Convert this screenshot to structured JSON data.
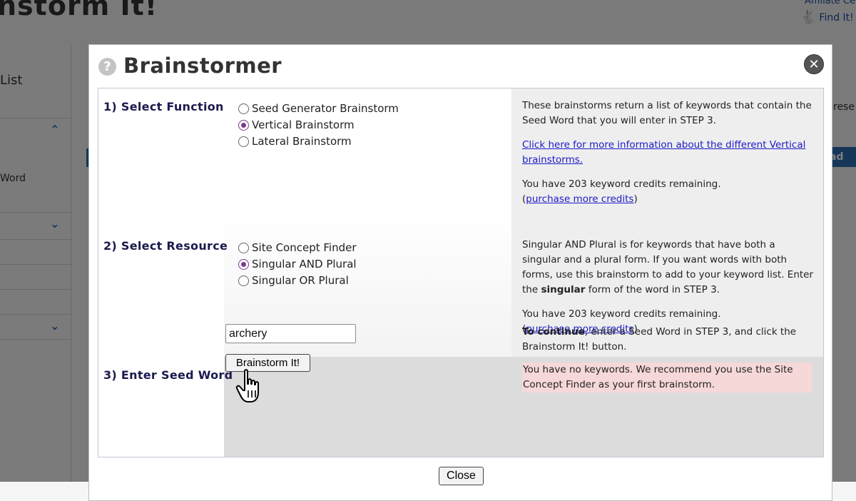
{
  "background": {
    "page_title": "nstorm It!",
    "affiliate_link": "Affiliate Ce",
    "find_link": "Find It!",
    "sidebar_list": "List",
    "sidebar_word": "Word",
    "right_text": "rese",
    "right_button": "ad"
  },
  "dialog": {
    "help_glyph": "?",
    "title": "Brainstormer",
    "close_x_glyph": "✕",
    "close_label": "Close",
    "step1": {
      "label": "1) Select Function",
      "options": [
        "Seed Generator Brainstorm",
        "Vertical Brainstorm",
        "Lateral Brainstorm"
      ],
      "selected": "Vertical Brainstorm",
      "info_text": "These brainstorms return a list of keywords that contain the Seed Word that you will enter in STEP 3.",
      "info_link": "Click here for more information about the different Vertical brainstorms.",
      "credits_text": "You have 203 keyword credits remaining.",
      "credits_open": "(",
      "purchase_link": "purchase more credits",
      "credits_close": ")"
    },
    "step2": {
      "label": "2) Select Resource",
      "options": [
        "Site Concept Finder",
        "Singular AND Plural",
        "Singular OR Plural"
      ],
      "selected": "Singular AND Plural",
      "info_text_before": "Singular AND Plural is for keywords that have both a singular and a plural form. If you want words with both forms, use this brainstorm to add to your keyword list. Enter the ",
      "info_text_bold": "singular",
      "info_text_after": " form of the word in STEP 3.",
      "credits_text": "You have 203 keyword credits remaining.",
      "credits_open": "(",
      "purchase_link": "purchase more credits",
      "credits_close": ")"
    },
    "step3": {
      "label": "3) Enter Seed Word",
      "seed_value": "archery",
      "button_label": "Brainstorm It!",
      "continue_bold": "To continue",
      "continue_text": ", enter a Seed Word in STEP 3, and click the Brainstorm It! button.",
      "warning_text": "You have no keywords. We recommend you use the Site Concept Finder as your first brainstorm."
    }
  },
  "colors": {
    "radio_accent": "#7a3b8f",
    "link": "#1a1ac8",
    "warning_bg": "#f6d8d8",
    "label_navy": "#1a1a4e"
  }
}
